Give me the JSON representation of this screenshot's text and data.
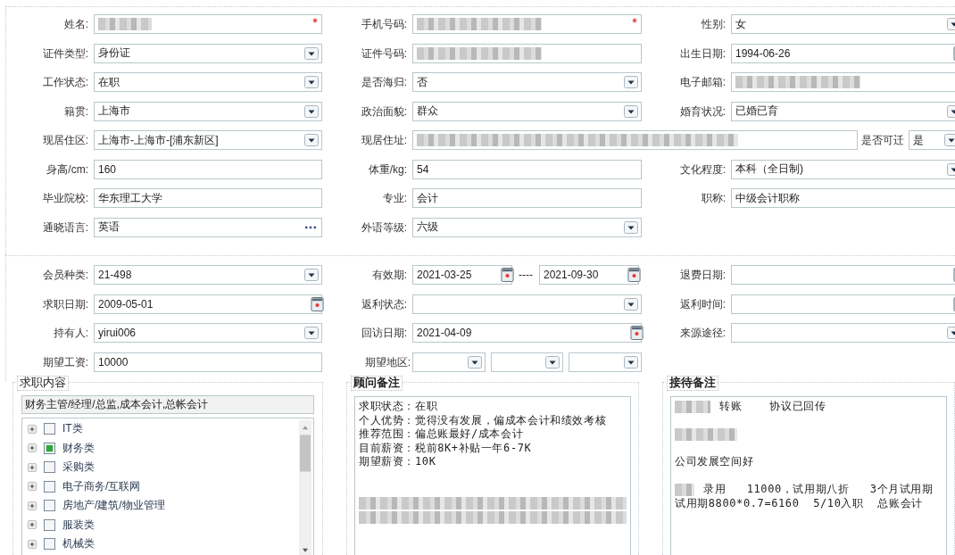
{
  "profile": {
    "rows": [
      {
        "kind": "standard",
        "fields": [
          {
            "label": "姓名:",
            "kind": "text",
            "redacted": true,
            "required": true
          },
          {
            "label": "手机号码:",
            "kind": "text",
            "redacted": true,
            "required": true
          },
          {
            "label": "性别:",
            "kind": "select",
            "value": "女"
          }
        ]
      },
      {
        "kind": "standard",
        "fields": [
          {
            "label": "证件类型:",
            "kind": "select",
            "value": "身份证"
          },
          {
            "label": "证件号码:",
            "kind": "text",
            "redacted": true
          },
          {
            "label": "出生日期:",
            "kind": "date",
            "value": "1994-06-26"
          }
        ]
      },
      {
        "kind": "standard",
        "fields": [
          {
            "label": "工作状态:",
            "kind": "select",
            "value": "在职"
          },
          {
            "label": "是否海归:",
            "kind": "select",
            "value": "否"
          },
          {
            "label": "电子邮箱:",
            "kind": "text",
            "redacted": true
          }
        ]
      },
      {
        "kind": "standard",
        "fields": [
          {
            "label": "籍贯:",
            "kind": "select",
            "value": "上海市"
          },
          {
            "label": "政治面貌:",
            "kind": "select",
            "value": "群众"
          },
          {
            "label": "婚育状况:",
            "kind": "select",
            "value": "已婚已育"
          }
        ]
      },
      {
        "kind": "address",
        "fields": [
          {
            "label": "现居住区:",
            "kind": "select",
            "value": " 上海市-上海市-[浦东新区]"
          },
          {
            "label": "现居住址:",
            "kind": "text",
            "redacted": true
          },
          {
            "label": "是否可迁",
            "kind": "select",
            "value": "是"
          }
        ]
      },
      {
        "kind": "standard",
        "fields": [
          {
            "label": "身高/cm:",
            "kind": "text",
            "value": "160"
          },
          {
            "label": "体重/kg:",
            "kind": "text",
            "value": "54"
          },
          {
            "label": "文化程度:",
            "kind": "select",
            "value": "本科（全日制)"
          }
        ]
      },
      {
        "kind": "standard",
        "fields": [
          {
            "label": "毕业院校:",
            "kind": "text",
            "value": "华东理工大学"
          },
          {
            "label": "专业:",
            "kind": "text",
            "value": "会计"
          },
          {
            "label": "职称:",
            "kind": "text",
            "value": "中级会计职称"
          }
        ]
      },
      {
        "kind": "standard",
        "fields": [
          {
            "label": "通晓语言:",
            "kind": "picker",
            "value": "英语"
          },
          {
            "label": "外语等级:",
            "kind": "select",
            "value": "六级"
          }
        ]
      }
    ]
  },
  "membership": {
    "rows": [
      {
        "kind": "standard",
        "fields": [
          {
            "label": "会员种类:",
            "kind": "select",
            "value": " 21-498"
          },
          {
            "label": "有效期:",
            "kind": "range",
            "value": "2021-03-25",
            "value_end": "2021-09-30",
            "separator": "----"
          },
          {
            "label": "退费日期:",
            "kind": "date"
          }
        ]
      },
      {
        "kind": "standard",
        "fields": [
          {
            "label": "求职日期:",
            "kind": "date",
            "value": "2009-05-01"
          },
          {
            "label": "返利状态:",
            "kind": "select"
          },
          {
            "label": "返利时间:",
            "kind": "date"
          }
        ]
      },
      {
        "kind": "standard",
        "fields": [
          {
            "label": "持有人:",
            "kind": "select",
            "value": "yirui006"
          },
          {
            "label": "回访日期:",
            "kind": "date",
            "value": "2021-04-09"
          },
          {
            "label": "来源途径:",
            "kind": "select"
          }
        ]
      },
      {
        "kind": "region",
        "fields": [
          {
            "label": "期望工资:",
            "kind": "text",
            "value": "10000"
          },
          {
            "label": "期望地区:",
            "kind": "region"
          }
        ]
      }
    ]
  },
  "job_intent": {
    "legend": "求职内容",
    "legend_bold": false,
    "summary": "财务主管/经理/总监,成本会计,总帐会计",
    "tree": [
      {
        "label": "IT类",
        "checked": false,
        "expanded": false
      },
      {
        "label": "财务类",
        "checked": true,
        "expanded": false
      },
      {
        "label": "采购类",
        "checked": false,
        "expanded": false
      },
      {
        "label": "电子商务/互联网",
        "checked": false,
        "expanded": false
      },
      {
        "label": "房地产/建筑/物业管理",
        "checked": false,
        "expanded": false
      },
      {
        "label": "服装类",
        "checked": false,
        "expanded": false
      },
      {
        "label": "机械类",
        "checked": false,
        "expanded": false
      }
    ]
  },
  "notes": [
    {
      "legend": "顾问备注",
      "legend_bold": true,
      "lines": [
        {
          "kind": "text",
          "text": "求职状态：在职"
        },
        {
          "kind": "text",
          "text": "个人优势：觉得没有发展，偏成本会计和绩效考核"
        },
        {
          "kind": "text",
          "text": "推荐范围：偏总账最好/成本会计"
        },
        {
          "kind": "text",
          "text": "目前薪资：税前8K+补贴一年6-7K"
        },
        {
          "kind": "text",
          "text": "期望薪资：10K"
        },
        {
          "kind": "blank"
        },
        {
          "kind": "blank"
        },
        {
          "kind": "redacted"
        },
        {
          "kind": "redacted"
        }
      ]
    },
    {
      "legend": "接待备注",
      "legend_bold": true,
      "lines": [
        {
          "kind": "text",
          "text": "转账    协议已回传",
          "redacted_prefix": true
        },
        {
          "kind": "blank"
        },
        {
          "kind": "redacted"
        },
        {
          "kind": "blank"
        },
        {
          "kind": "text",
          "text": "公司发展空间好"
        },
        {
          "kind": "blank"
        },
        {
          "kind": "text",
          "text": "录用   11000，试用期八折   3个月试用期",
          "redacted_prefix": true
        },
        {
          "kind": "text",
          "text": "试用期8800*0.7=6160  5/10入职  总账会计"
        }
      ]
    }
  ]
}
